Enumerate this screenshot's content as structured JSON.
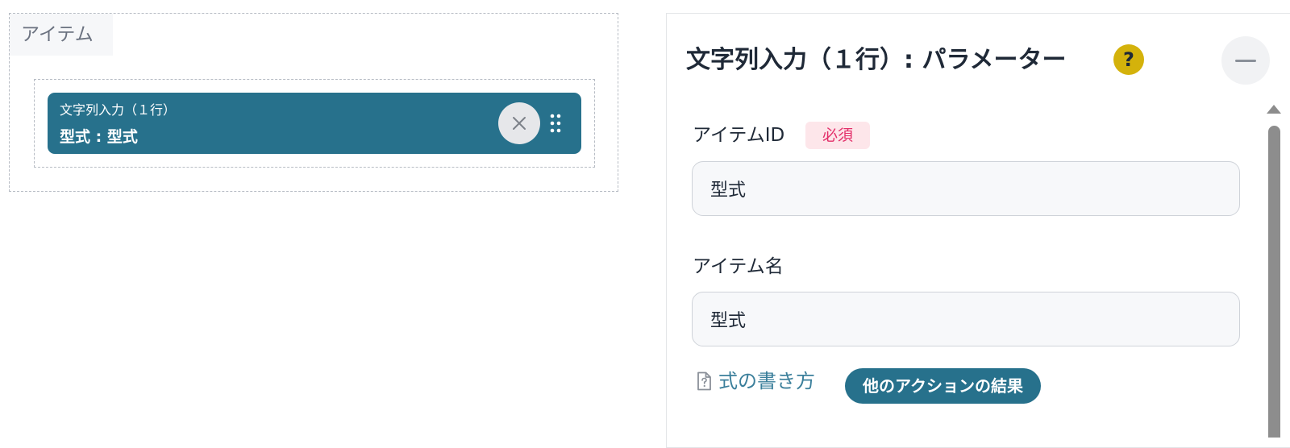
{
  "canvas": {
    "section_label": "アイテム",
    "item": {
      "type_label": "文字列入力（１行）",
      "title": "型式 : 型式"
    },
    "icons": {
      "remove": "close-icon",
      "drag": "drag-handle-icon"
    }
  },
  "panel": {
    "title": "文字列入力（１行）: パラメーター",
    "help_symbol": "?",
    "icons": {
      "help": "question-circle-icon",
      "collapse": "minus-icon",
      "doc": "document-question-icon"
    },
    "fields": {
      "item_id": {
        "label": "アイテムID",
        "badge": "必須",
        "value": "型式"
      },
      "item_name": {
        "label": "アイテム名",
        "value": "型式"
      }
    },
    "formula_link": "式の書き方",
    "action_chip": "他のアクションの結果"
  },
  "colors": {
    "accent": "#27718c",
    "help": "#d4b20b",
    "required_text": "#e3306a",
    "required_bg": "#fde6ea",
    "link": "#3b7f9b"
  }
}
